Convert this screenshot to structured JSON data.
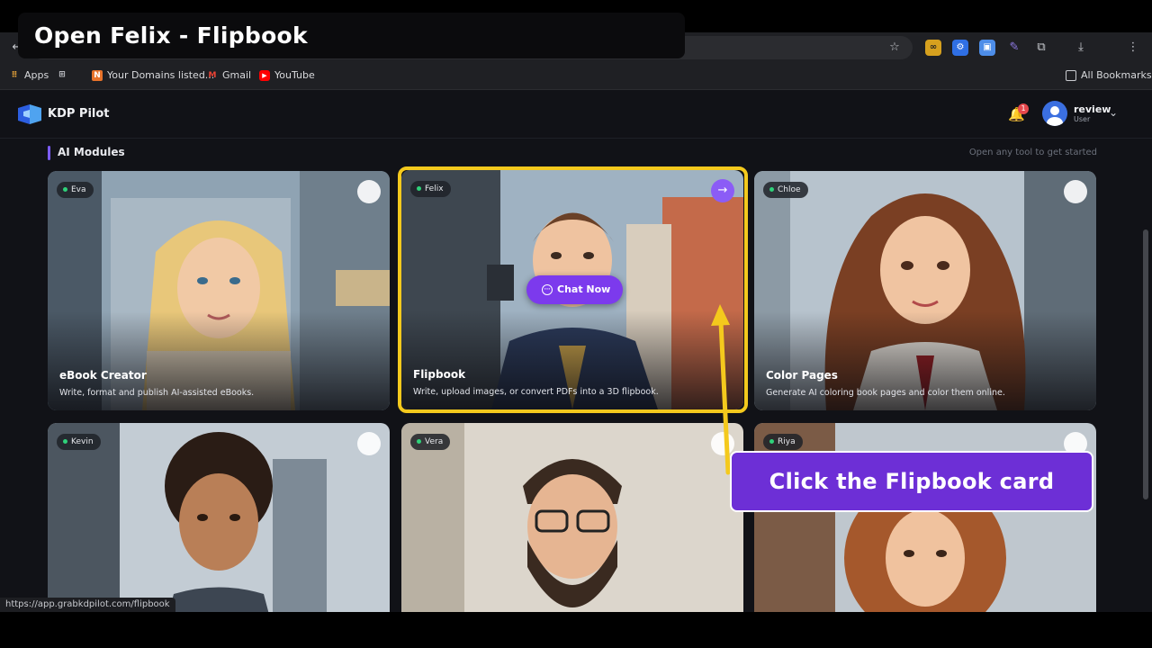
{
  "overlay": {
    "step_title": "Open Felix - Flipbook",
    "callout": "Click the Flipbook card"
  },
  "browser": {
    "bookmarks": [
      {
        "label": "Apps",
        "icon": "apps-grid-icon"
      },
      {
        "label": "",
        "icon": "tab-groups-icon"
      },
      {
        "label": "Your Domains listed...",
        "icon": "domain-favicon"
      },
      {
        "label": "Gmail",
        "icon": "gmail-icon"
      },
      {
        "label": "YouTube",
        "icon": "youtube-icon"
      }
    ],
    "all_bookmarks": "All Bookmarks",
    "status_url": "https://app.grabkdpilot.com/flipbook"
  },
  "app": {
    "brand": "KDP Pilot",
    "notifications": "1",
    "user": {
      "name": "review",
      "role": "User"
    },
    "section_title": "AI Modules",
    "section_hint": "Open any tool to get started"
  },
  "cards": [
    {
      "persona": "Eva",
      "title": "eBook Creator",
      "desc": "Write, format and publish AI-assisted eBooks."
    },
    {
      "persona": "Felix",
      "title": "Flipbook",
      "desc": "Write, upload images, or convert PDFs into a 3D flipbook.",
      "action": "Chat Now"
    },
    {
      "persona": "Chloe",
      "title": "Color Pages",
      "desc": "Generate AI coloring book pages and color them online."
    },
    {
      "persona": "Kevin",
      "title": "",
      "desc": ""
    },
    {
      "persona": "Vera",
      "title": "",
      "desc": ""
    },
    {
      "persona": "Riya",
      "title": "",
      "desc": ""
    }
  ],
  "colors": {
    "accent": "#7c3aed",
    "highlight": "#f4c91d",
    "callout": "#6d2fd6",
    "background": "#111217"
  }
}
